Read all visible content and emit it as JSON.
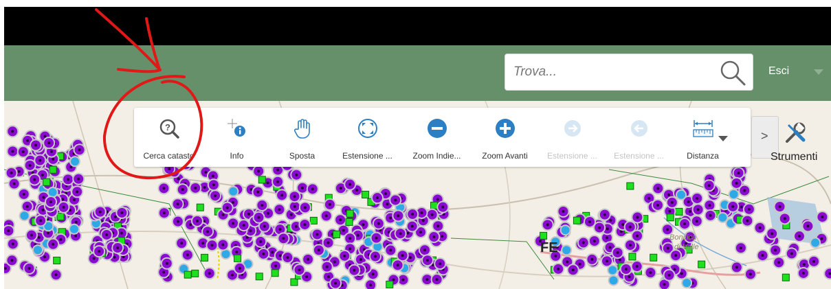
{
  "search": {
    "placeholder": "Trova..."
  },
  "header": {
    "logout_label": "Esci"
  },
  "toolbar": {
    "tools": [
      {
        "label": "Cerca catasto",
        "icon": "search-question-icon",
        "enabled": true
      },
      {
        "label": "Info",
        "icon": "info-icon",
        "enabled": true
      },
      {
        "label": "Sposta",
        "icon": "hand-pan-icon",
        "enabled": true
      },
      {
        "label": "Estensione ...",
        "icon": "full-extent-icon",
        "enabled": true
      },
      {
        "label": "Zoom Indie...",
        "icon": "zoom-out-icon",
        "enabled": true
      },
      {
        "label": "Zoom Avanti",
        "icon": "zoom-in-icon",
        "enabled": true
      },
      {
        "label": "Estensione ...",
        "icon": "next-extent-icon",
        "enabled": false
      },
      {
        "label": "Estensione ...",
        "icon": "previous-extent-icon",
        "enabled": false
      },
      {
        "label": "Distanza",
        "icon": "measure-distance-icon",
        "enabled": true
      }
    ],
    "more_label": ">",
    "tools_menu_label": "Strumenti"
  },
  "map": {
    "place_label": "FE",
    "area_label_1": "Bonifica",
    "area_label_2": "di Valle"
  },
  "colors": {
    "header": "#66906a",
    "topbar": "#000000",
    "marker_purple": "#8a0ad0",
    "marker_green": "#1ee01e",
    "marker_blue": "#2fa8e8",
    "annotation_red": "#e01818",
    "tool_blue": "#2c7fc2"
  }
}
